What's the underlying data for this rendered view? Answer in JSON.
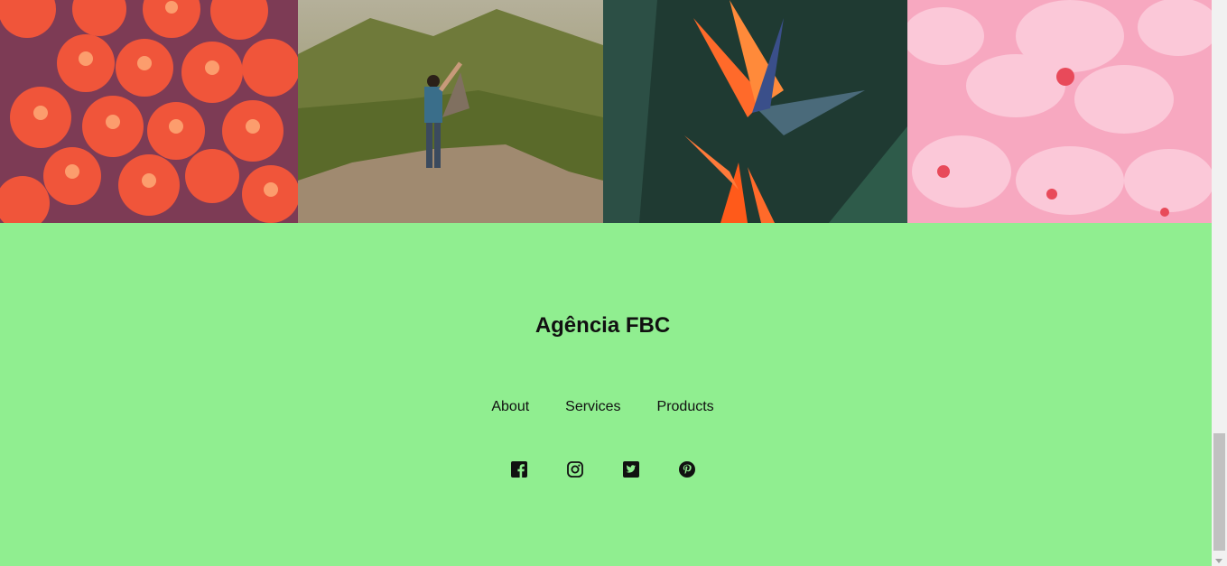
{
  "gallery": {
    "images": [
      {
        "icon": "tomatoes-photo"
      },
      {
        "icon": "mountain-hiker-photo"
      },
      {
        "icon": "bird-of-paradise-flower-photo"
      },
      {
        "icon": "pink-flowers-photo"
      }
    ]
  },
  "footer": {
    "brand": "Agência FBC",
    "background_color": "#90ee90",
    "nav": {
      "about": "About",
      "services": "Services",
      "products": "Products"
    },
    "social": [
      "facebook-icon",
      "instagram-icon",
      "twitter-icon",
      "pinterest-icon"
    ]
  }
}
